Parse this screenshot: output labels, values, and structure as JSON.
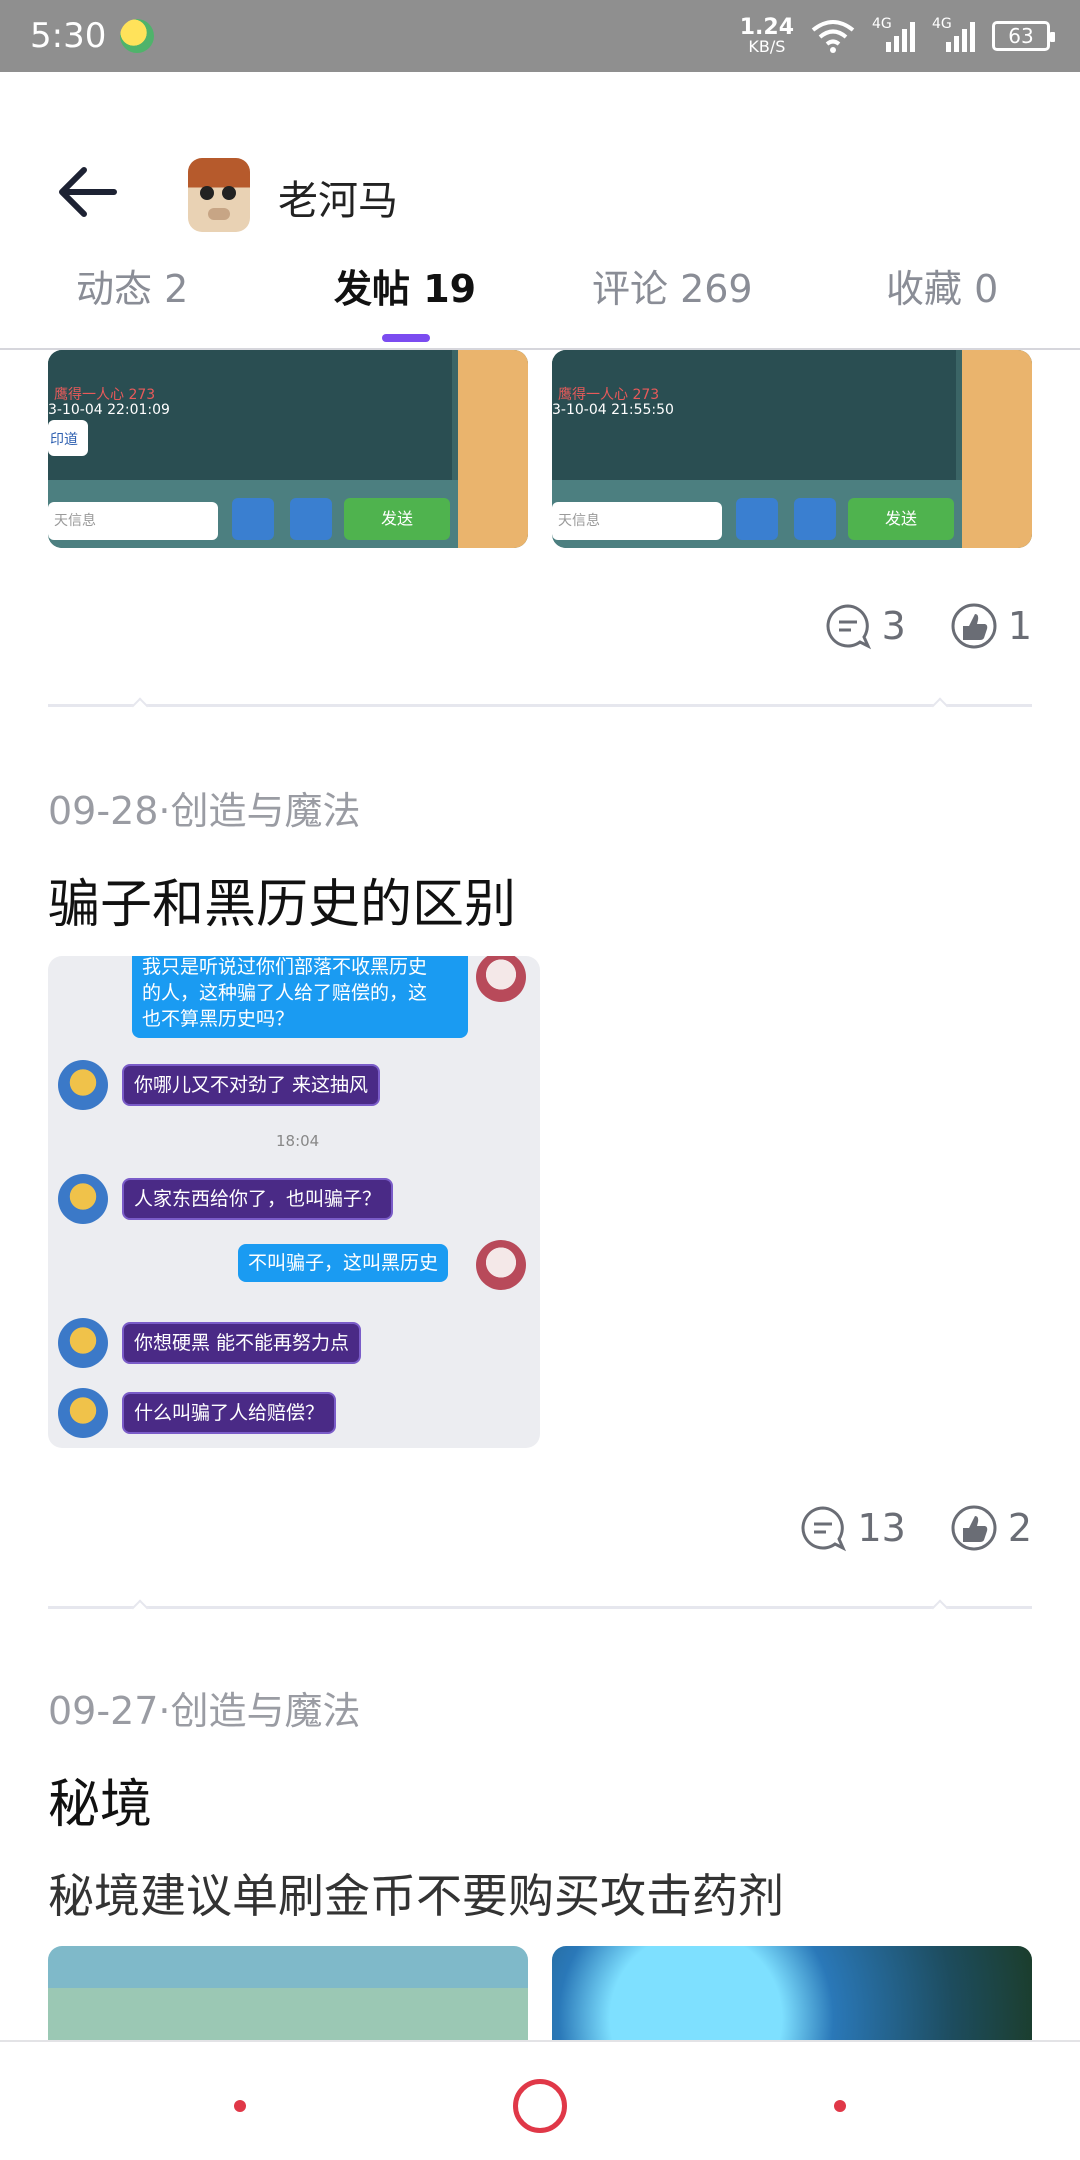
{
  "status_bar": {
    "time": "5:30",
    "net_speed_value": "1.24",
    "net_speed_unit": "KB/S",
    "network_1": "4G",
    "network_2": "4G",
    "battery": "63"
  },
  "header": {
    "username": "老河马",
    "tabs": [
      {
        "label": "动态 2",
        "active": false
      },
      {
        "label": "发帖 19",
        "active": true
      },
      {
        "label": "评论 269",
        "active": false
      },
      {
        "label": "收藏 0",
        "active": false
      }
    ],
    "accent_color": "#7b4cf0"
  },
  "posts": [
    {
      "images": [
        {
          "kind": "game-screenshot",
          "location_text": "鹰得一人心 273",
          "datetime_text": "3-10-04  22:01:09",
          "chip_text": "印道",
          "input_placeholder": "天信息",
          "send_label": "发送"
        },
        {
          "kind": "game-screenshot",
          "location_text": "鹰得一人心 273",
          "datetime_text": "3-10-04  21:55:50",
          "input_placeholder": "天信息",
          "send_label": "发送"
        }
      ],
      "comments": "3",
      "likes": "1"
    },
    {
      "meta": "09-28·创造与魔法",
      "title": "骗子和黑历史的区别",
      "chat": {
        "messages": [
          {
            "side": "me",
            "text": "我只是听说过你们部落不收黑历史\n的人，这种骗了人给了赔偿的，这\n也不算黑历史吗？"
          },
          {
            "side": "them",
            "text": "你哪儿又不对劲了 来这抽风"
          },
          {
            "side": "time",
            "text": "18:04"
          },
          {
            "side": "them",
            "text": "人家东西给你了，也叫骗子？"
          },
          {
            "side": "me",
            "text": "不叫骗子，这叫黑历史"
          },
          {
            "side": "them",
            "text": "你想硬黑 能不能再努力点"
          },
          {
            "side": "them",
            "text": "什么叫骗了人给赔偿？"
          }
        ]
      },
      "comments": "13",
      "likes": "2"
    },
    {
      "meta": "09-27·创造与魔法",
      "title": "秘境",
      "body": "秘境建议单刷金币不要购买攻击药剂"
    }
  ],
  "nav_color": "#e03848"
}
